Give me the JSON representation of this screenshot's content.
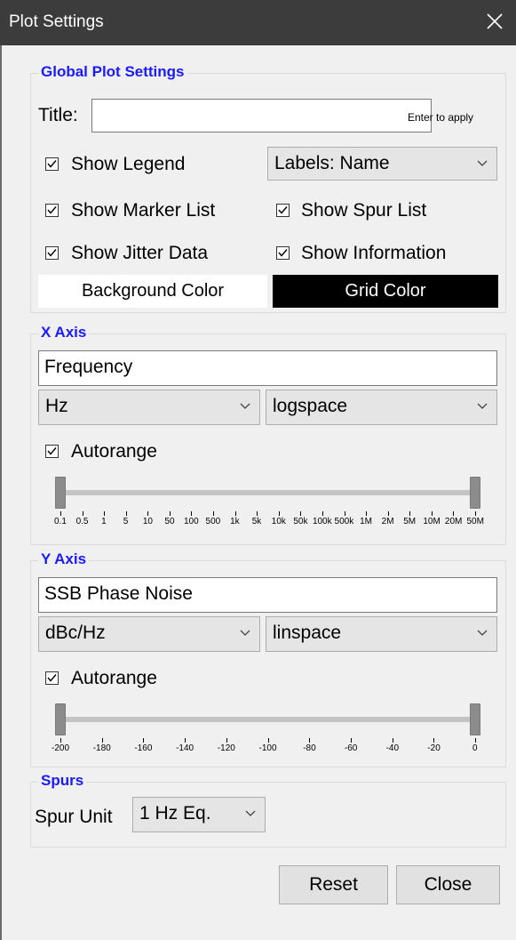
{
  "window": {
    "title": "Plot Settings"
  },
  "global": {
    "group_title": "Global Plot Settings",
    "title_label": "Title:",
    "title_value": "",
    "enter_hint": "Enter to apply",
    "show_legend": "Show Legend",
    "labels_select": "Labels: Name",
    "show_marker_list": "Show Marker List",
    "show_spur_list": "Show Spur List",
    "show_jitter_data": "Show Jitter Data",
    "show_information": "Show Information",
    "background_color_label": "Background Color",
    "grid_color_label": "Grid Color",
    "background_color": "#ffffff",
    "grid_color": "#000000",
    "checks": {
      "legend": true,
      "marker_list": true,
      "spur_list": true,
      "jitter_data": true,
      "information": true
    }
  },
  "xaxis": {
    "group_title": "X Axis",
    "label_value": "Frequency",
    "unit": "Hz",
    "spacing": "logspace",
    "autorange_label": "Autorange",
    "autorange": true,
    "ticks": [
      "0.1",
      "0.5",
      "1",
      "5",
      "10",
      "50",
      "100",
      "500",
      "1k",
      "5k",
      "10k",
      "50k",
      "100k",
      "500k",
      "1M",
      "2M",
      "5M",
      "10M",
      "20M",
      "50M"
    ]
  },
  "yaxis": {
    "group_title": "Y Axis",
    "label_value": "SSB Phase Noise",
    "unit": "dBc/Hz",
    "spacing": "linspace",
    "autorange_label": "Autorange",
    "autorange": true,
    "ticks": [
      "-200",
      "-180",
      "-160",
      "-140",
      "-120",
      "-100",
      "-80",
      "-60",
      "-40",
      "-20",
      "0"
    ]
  },
  "spurs": {
    "group_title": "Spurs",
    "unit_label": "Spur Unit",
    "unit_value": "1 Hz Eq."
  },
  "buttons": {
    "reset": "Reset",
    "close": "Close"
  }
}
